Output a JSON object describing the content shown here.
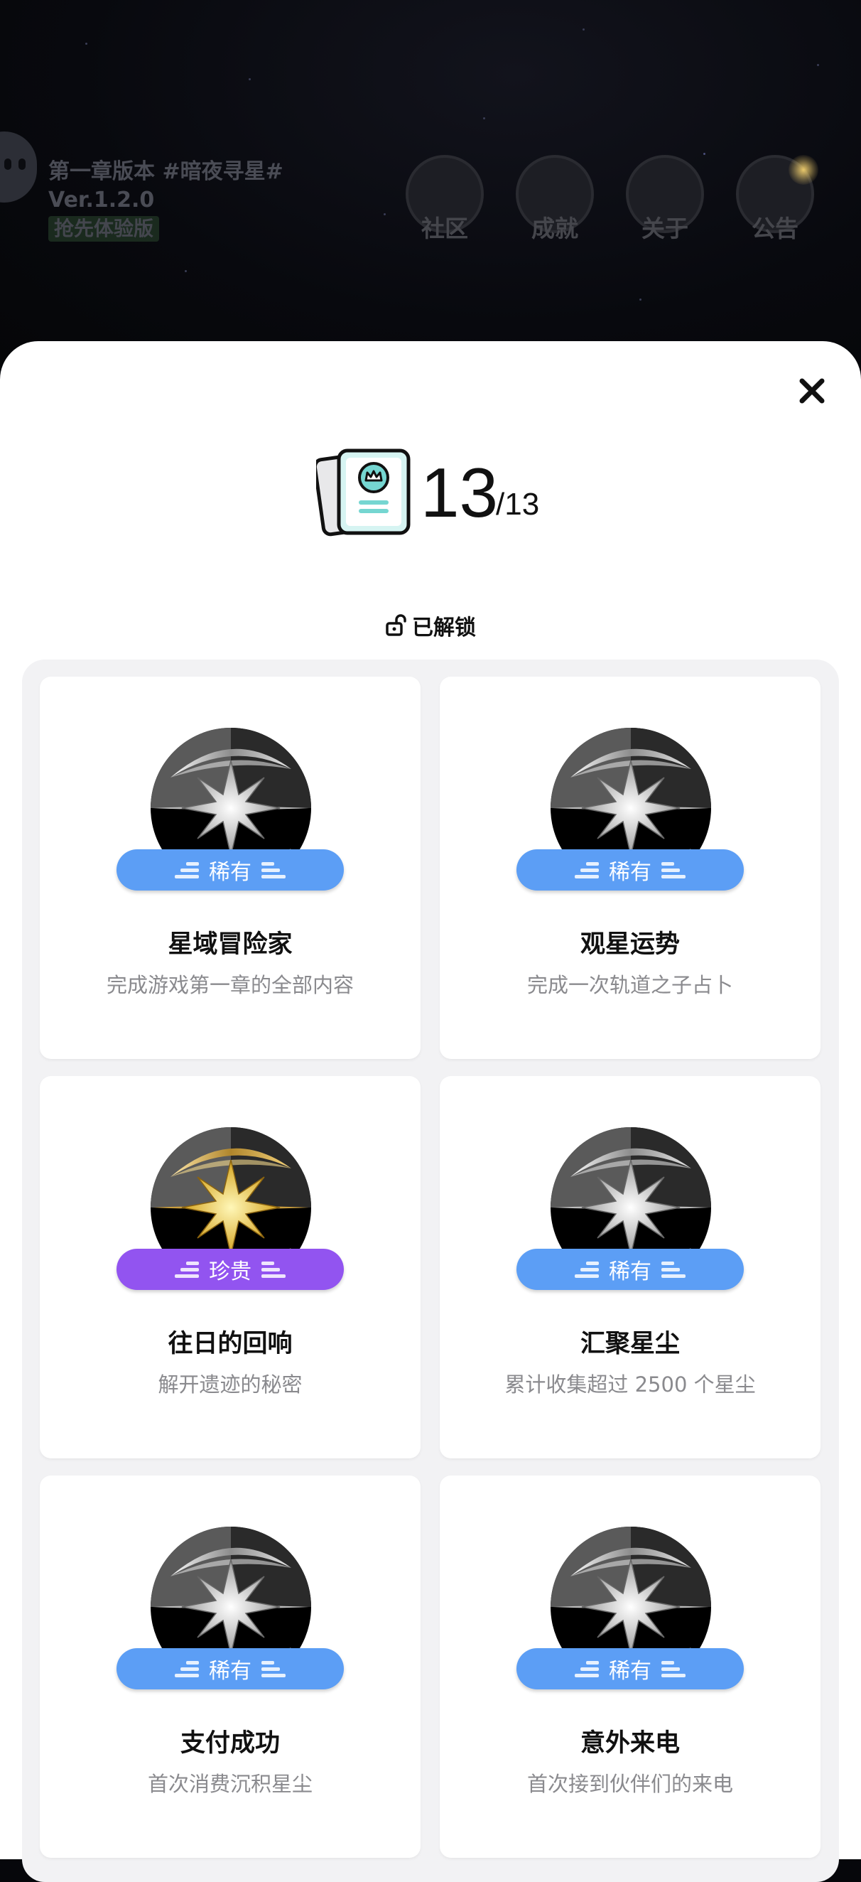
{
  "background": {
    "chapter_title": "第一章版本 #暗夜寻星#",
    "version": "Ver.1.2.0",
    "tag": "抢先体验版",
    "nav": [
      {
        "label": "社区",
        "icon": "community-icon"
      },
      {
        "label": "成就",
        "icon": "achievement-icon"
      },
      {
        "label": "关于",
        "icon": "about-icon"
      },
      {
        "label": "公告",
        "icon": "announcement-icon"
      }
    ]
  },
  "panel": {
    "close_icon": "close-icon",
    "collection_icon": "achievement-cards-icon",
    "unlocked_count": "13",
    "total_count": "/13",
    "section_label": "已解锁",
    "section_icon": "unlock-icon"
  },
  "achievements": [
    {
      "title": "星域冒险家",
      "desc": "完成游戏第一章的全部内容",
      "rarity": "稀有",
      "tier": "rare",
      "badge": "silver-star-badge"
    },
    {
      "title": "观星运势",
      "desc": "完成一次轨道之子占卜",
      "rarity": "稀有",
      "tier": "rare",
      "badge": "silver-star-badge"
    },
    {
      "title": "往日的回响",
      "desc": "解开遗迹的秘密",
      "rarity": "珍贵",
      "tier": "epic",
      "badge": "gold-star-badge"
    },
    {
      "title": "汇聚星尘",
      "desc": "累计收集超过 2500 个星尘",
      "rarity": "稀有",
      "tier": "rare",
      "badge": "silver-star-badge"
    },
    {
      "title": "支付成功",
      "desc": "首次消费沉积星尘",
      "rarity": "稀有",
      "tier": "rare",
      "badge": "silver-star-badge"
    },
    {
      "title": "意外来电",
      "desc": "首次接到伙伴们的来电",
      "rarity": "稀有",
      "tier": "rare",
      "badge": "silver-star-badge"
    }
  ],
  "colors": {
    "rare": "#5c9ef5",
    "epic": "#9254f0",
    "card_bg": "#ffffff",
    "grid_bg": "#f2f2f4"
  }
}
